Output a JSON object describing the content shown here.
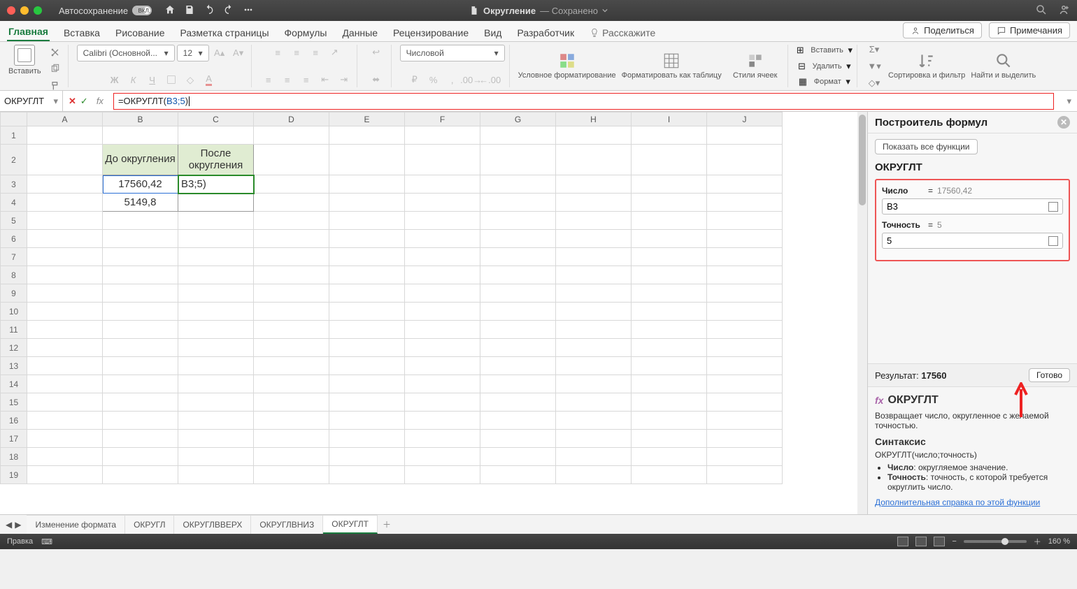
{
  "titlebar": {
    "autosave": "Автосохранение",
    "toggle": "ВКЛ.",
    "doc_name": "Округление",
    "saved": "— Сохранено"
  },
  "tabs": {
    "home": "Главная",
    "insert": "Вставка",
    "draw": "Рисование",
    "layout": "Разметка страницы",
    "formulas": "Формулы",
    "data": "Данные",
    "review": "Рецензирование",
    "view": "Вид",
    "developer": "Разработчик",
    "tellme": "Расскажите",
    "share": "Поделиться",
    "comments": "Примечания"
  },
  "ribbon": {
    "paste": "Вставить",
    "font_name": "Calibri (Основной...",
    "font_size": "12",
    "number_format": "Числовой",
    "cond": "Условное форматирование",
    "fmt_tbl": "Форматировать как таблицу",
    "styles": "Стили ячеек",
    "ins": "Вставить",
    "del": "Удалить",
    "fmt": "Формат",
    "sort": "Сортировка и фильтр",
    "find": "Найти и выделить"
  },
  "formula": {
    "namebox": "ОКРУГЛТ",
    "fx": "fx",
    "prefix": "=ОКРУГЛТ(",
    "arg": "B3;5",
    "suffix": ")"
  },
  "columns": [
    "A",
    "B",
    "C",
    "D",
    "E",
    "F",
    "G",
    "H",
    "I",
    "J"
  ],
  "rows": [
    "1",
    "2",
    "3",
    "4",
    "5",
    "6",
    "7",
    "8",
    "9",
    "10",
    "11",
    "12",
    "13",
    "14",
    "15",
    "16",
    "17",
    "18",
    "19"
  ],
  "cells": {
    "b2": "До округления",
    "c2": "После округления",
    "b3": "17560,42",
    "c3": "B3;5)",
    "b4": "5149,8"
  },
  "sidepanel": {
    "title": "Построитель формул",
    "show_all": "Показать все функции",
    "func": "ОКРУГЛТ",
    "arg1_label": "Число",
    "arg1_eq": "=",
    "arg1_val": "17560,42",
    "arg1_input": "B3",
    "arg2_label": "Точность",
    "arg2_eq": "=",
    "arg2_val": "5",
    "arg2_input": "5",
    "result_label": "Результат:",
    "result_val": "17560",
    "done": "Готово",
    "desc": "Возвращает число, округленное с желаемой точностью.",
    "syntax_h": "Синтаксис",
    "syntax": "ОКРУГЛТ(число;точность)",
    "p1_b": "Число",
    "p1": ": округляемое значение.",
    "p2_b": "Точность",
    "p2": ": точность, с которой требуется округлить число.",
    "more": "Дополнительная справка по этой функции"
  },
  "sheets": {
    "s1": "Изменение формата",
    "s2": "ОКРУГЛ",
    "s3": "ОКРУГЛВВЕРХ",
    "s4": "ОКРУГЛВНИЗ",
    "s5": "ОКРУГЛТ"
  },
  "status": {
    "mode": "Правка",
    "zoom": "160 %"
  }
}
